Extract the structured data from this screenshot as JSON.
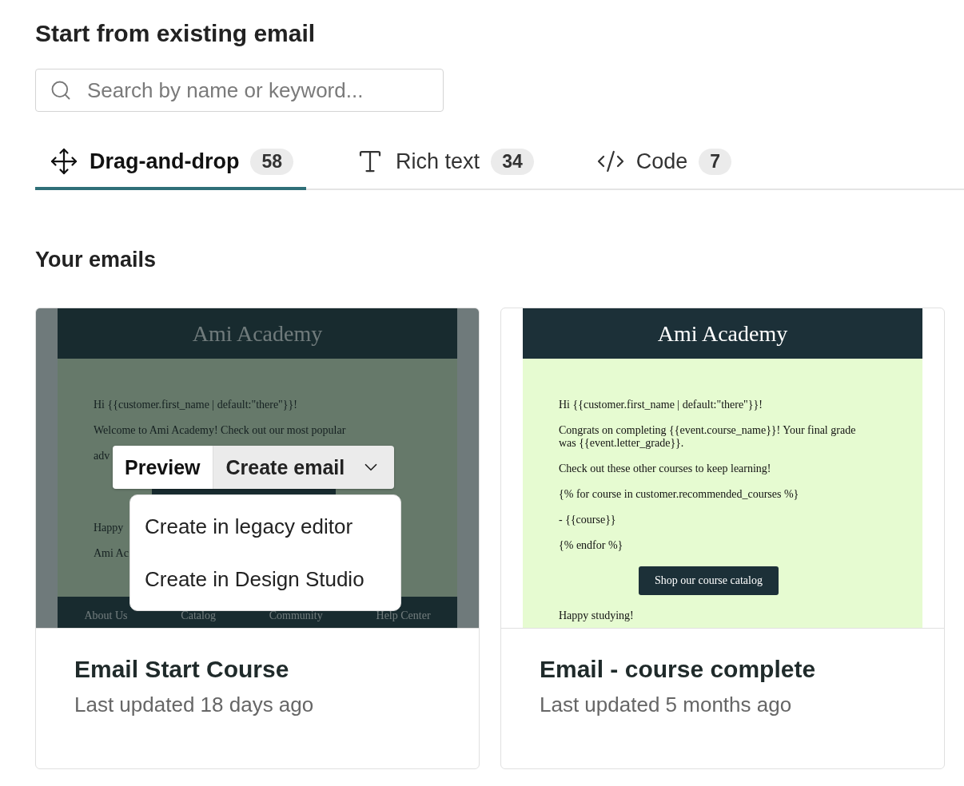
{
  "title": "Start from existing email",
  "search": {
    "placeholder": "Search by name or keyword..."
  },
  "tabs": [
    {
      "label": "Drag-and-drop",
      "count": "58",
      "selected": true
    },
    {
      "label": "Rich text",
      "count": "34",
      "selected": false
    },
    {
      "label": "Code",
      "count": "7",
      "selected": false
    }
  ],
  "section_title": "Your emails",
  "emails": [
    {
      "name": "Email Start Course",
      "updated": "Last updated 18 days ago",
      "hovered": true,
      "preview": {
        "brand": "Ami Academy",
        "blocks": [
          {
            "kind": "text",
            "text": "Hi {{customer.first_name | default:\"there\"}}!"
          },
          {
            "kind": "clipped",
            "lines": [
              "Welcome to Ami Academy! Check out our most popular",
              "adv"
            ]
          },
          {
            "kind": "button"
          },
          {
            "kind": "text",
            "text": "Happy"
          },
          {
            "kind": "text",
            "text": "Ami Ac"
          }
        ],
        "footer_links": [
          "About Us",
          "Catalog",
          "Community",
          "Help Center"
        ]
      },
      "actions": {
        "preview": "Preview",
        "create": "Create email",
        "menu_open": true,
        "menu": [
          "Create in legacy editor",
          "Create in Design Studio"
        ]
      }
    },
    {
      "name": "Email - course complete",
      "updated": "Last updated 5 months ago",
      "hovered": false,
      "preview": {
        "brand": "Ami Academy",
        "blocks": [
          {
            "kind": "text",
            "text": "Hi {{customer.first_name | default:\"there\"}}!"
          },
          {
            "kind": "text",
            "text": "Congrats on completing {{event.course_name}}! Your final grade was {{event.letter_grade}}."
          },
          {
            "kind": "text",
            "text": "Check out these other courses to keep learning!"
          },
          {
            "kind": "text",
            "text": "{% for course in customer.recommended_courses %}"
          },
          {
            "kind": "text",
            "text": "- {{course}}"
          },
          {
            "kind": "text",
            "text": "{% endfor %}"
          },
          {
            "kind": "button",
            "label": "Shop our course catalog"
          },
          {
            "kind": "text",
            "text": "Happy studying!"
          }
        ]
      }
    }
  ]
}
